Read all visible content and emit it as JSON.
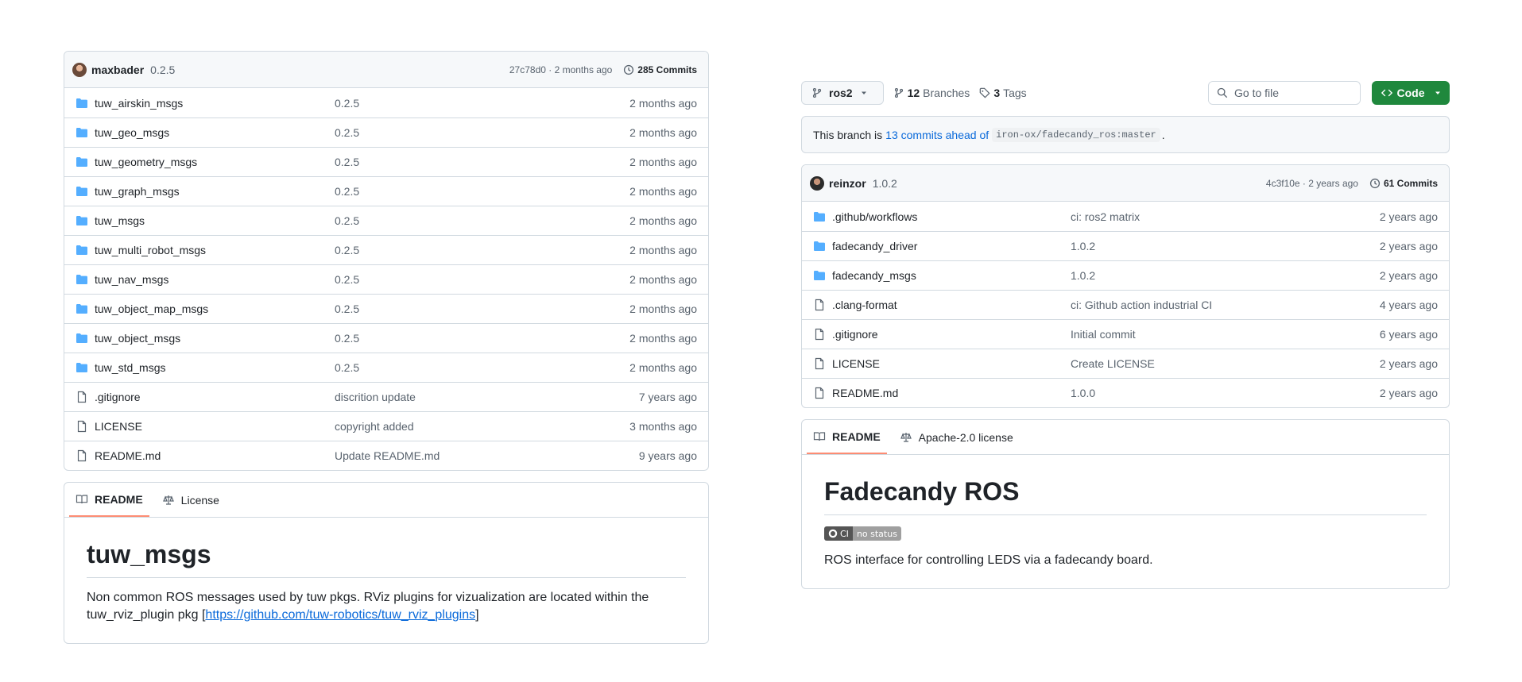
{
  "left": {
    "commit": {
      "author": "maxbader",
      "message": "0.2.5",
      "hash_age": "27c78d0 · 2 months ago",
      "commits_label": "285 Commits"
    },
    "files": [
      {
        "type": "folder",
        "name": "tuw_airskin_msgs",
        "msg": "0.2.5",
        "age": "2 months ago"
      },
      {
        "type": "folder",
        "name": "tuw_geo_msgs",
        "msg": "0.2.5",
        "age": "2 months ago"
      },
      {
        "type": "folder",
        "name": "tuw_geometry_msgs",
        "msg": "0.2.5",
        "age": "2 months ago"
      },
      {
        "type": "folder",
        "name": "tuw_graph_msgs",
        "msg": "0.2.5",
        "age": "2 months ago"
      },
      {
        "type": "folder",
        "name": "tuw_msgs",
        "msg": "0.2.5",
        "age": "2 months ago"
      },
      {
        "type": "folder",
        "name": "tuw_multi_robot_msgs",
        "msg": "0.2.5",
        "age": "2 months ago"
      },
      {
        "type": "folder",
        "name": "tuw_nav_msgs",
        "msg": "0.2.5",
        "age": "2 months ago"
      },
      {
        "type": "folder",
        "name": "tuw_object_map_msgs",
        "msg": "0.2.5",
        "age": "2 months ago"
      },
      {
        "type": "folder",
        "name": "tuw_object_msgs",
        "msg": "0.2.5",
        "age": "2 months ago"
      },
      {
        "type": "folder",
        "name": "tuw_std_msgs",
        "msg": "0.2.5",
        "age": "2 months ago"
      },
      {
        "type": "file",
        "name": ".gitignore",
        "msg": "discrition update",
        "age": "7 years ago"
      },
      {
        "type": "file",
        "name": "LICENSE",
        "msg": "copyright added",
        "age": "3 months ago"
      },
      {
        "type": "file",
        "name": "README.md",
        "msg": "Update README.md",
        "age": "9 years ago"
      }
    ],
    "readme": {
      "tab_readme": "README",
      "tab_license": "License",
      "title": "tuw_msgs",
      "text_before": "Non common ROS messages used by tuw pkgs. RViz plugins for vizualization are located within the tuw_rviz_plugin pkg [",
      "link": "https://github.com/tuw-robotics/tuw_rviz_plugins",
      "text_after": "]"
    }
  },
  "right": {
    "toolbar": {
      "branch": "ros2",
      "branches_count": "12",
      "branches_label": "Branches",
      "tags_count": "3",
      "tags_label": "Tags",
      "search_placeholder": "Go to file",
      "code_label": "Code"
    },
    "ahead": {
      "prefix": "This branch is",
      "link": "13 commits ahead of",
      "ref": "iron-ox/fadecandy_ros:master",
      "suffix": "."
    },
    "commit": {
      "author": "reinzor",
      "message": "1.0.2",
      "hash_age": "4c3f10e · 2 years ago",
      "commits_label": "61 Commits"
    },
    "files": [
      {
        "type": "folder",
        "name": ".github/workflows",
        "msg": "ci: ros2 matrix",
        "age": "2 years ago"
      },
      {
        "type": "folder",
        "name": "fadecandy_driver",
        "msg": "1.0.2",
        "age": "2 years ago"
      },
      {
        "type": "folder",
        "name": "fadecandy_msgs",
        "msg": "1.0.2",
        "age": "2 years ago"
      },
      {
        "type": "file",
        "name": ".clang-format",
        "msg": "ci: Github action industrial CI",
        "age": "4 years ago"
      },
      {
        "type": "file",
        "name": ".gitignore",
        "msg": "Initial commit",
        "age": "6 years ago"
      },
      {
        "type": "file",
        "name": "LICENSE",
        "msg": "Create LICENSE",
        "age": "2 years ago"
      },
      {
        "type": "file",
        "name": "README.md",
        "msg": "1.0.0",
        "age": "2 years ago"
      }
    ],
    "readme": {
      "tab_readme": "README",
      "tab_license": "Apache-2.0 license",
      "title": "Fadecandy ROS",
      "badge_left": "CI",
      "badge_right": "no status",
      "text": "ROS interface for controlling LEDS via a fadecandy board."
    }
  },
  "colors": {
    "accent_link": "#0969da",
    "folder_icon": "#54aeff",
    "code_button": "#1f883d",
    "tab_underline": "#fd8c73"
  }
}
